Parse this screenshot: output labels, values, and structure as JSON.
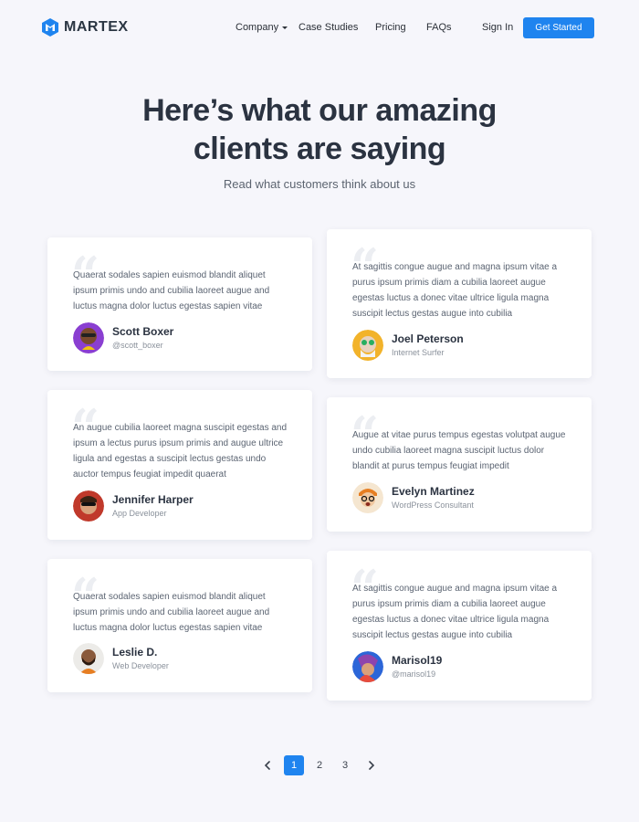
{
  "header": {
    "brand": "MARTEX",
    "nav": {
      "company": "Company",
      "case_studies": "Case Studies",
      "pricing": "Pricing",
      "faqs": "FAQs"
    },
    "sign_in": "Sign In",
    "cta": "Get Started"
  },
  "hero": {
    "title_line1": "Here’s what our amazing",
    "title_line2": "clients are saying",
    "subtitle": "Read what customers think about us"
  },
  "testimonials": [
    {
      "text": "Quaerat sodales sapien euismod blandit aliquet ipsum primis undo and cubilia laoreet augue and luctus magna dolor luctus egestas sapien vitae",
      "name": "Scott Boxer",
      "role": "@scott_boxer",
      "avatar_color": "#8a3fd1"
    },
    {
      "text": "At sagittis congue augue and magna ipsum vitae a purus ipsum primis diam a cubilia laoreet augue egestas luctus a donec vitae ultrice ligula magna suscipit lectus gestas augue into cubilia",
      "name": "Joel Peterson",
      "role": "Internet Surfer",
      "avatar_color": "#f2b32b"
    },
    {
      "text": "An augue cubilia laoreet magna suscipit egestas and ipsum a lectus purus ipsum primis and augue ultrice ligula and egestas a suscipit lectus gestas undo auctor tempus feugiat impedit quaerat",
      "name": "Jennifer Harper",
      "role": "App Developer",
      "avatar_color": "#c0392b"
    },
    {
      "text": "Augue at vitae purus tempus egestas volutpat augue undo cubilia laoreet magna suscipit luctus dolor blandit at purus tempus feugiat impedit",
      "name": "Evelyn Martinez",
      "role": "WordPress Consultant",
      "avatar_color": "#f39c12"
    },
    {
      "text": "Quaerat sodales sapien euismod blandit aliquet ipsum primis undo and cubilia laoreet augue and luctus magna dolor luctus egestas sapien vitae",
      "name": "Leslie D.",
      "role": "Web Developer",
      "avatar_color": "#e67e22"
    },
    {
      "text": "At sagittis congue augue and magna ipsum vitae a purus ipsum primis diam a cubilia laoreet augue egestas luctus a donec vitae ultrice ligula magna suscipit lectus gestas augue into cubilia",
      "name": "Marisol19",
      "role": "@marisol19",
      "avatar_color": "#2c66d8"
    }
  ],
  "pagination": {
    "pages": [
      "1",
      "2",
      "3"
    ],
    "active": "1"
  },
  "colors": {
    "accent": "#1f84ef",
    "background": "#f6f6fb",
    "heading": "#2b3341"
  }
}
